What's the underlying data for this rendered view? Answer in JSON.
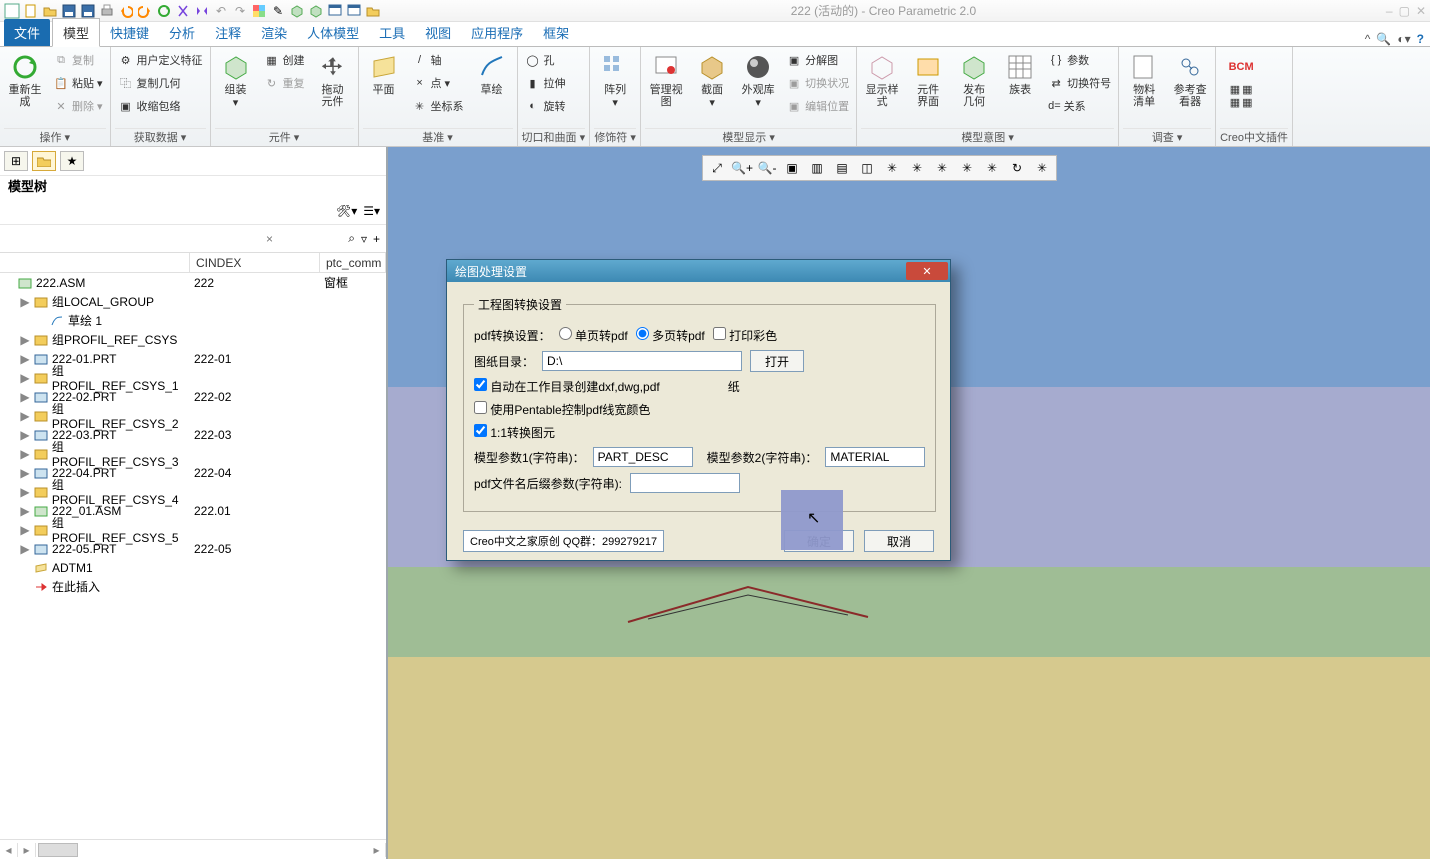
{
  "title": "222 (活动的) - Creo Parametric 2.0",
  "tabs": {
    "file": "文件",
    "list": [
      "模型",
      "快捷键",
      "分析",
      "注释",
      "渲染",
      "人体模型",
      "工具",
      "视图",
      "应用程序",
      "框架"
    ],
    "active": 0
  },
  "ribbon": {
    "g0": {
      "title": "操作",
      "regen": "重新生成",
      "copy": "复制",
      "paste": "粘贴",
      "del": "删除"
    },
    "g1": {
      "title": "获取数据",
      "udf": "用户定义特征",
      "copygeom": "复制几何",
      "shrink": "收缩包络"
    },
    "g2": {
      "title": "元件",
      "asm": "组装",
      "create": "创建",
      "repeat": "重复",
      "drag": "拖动\n元件"
    },
    "g3": {
      "title": "基准",
      "plane": "平面",
      "axis": "轴",
      "point": "点",
      "csys": "坐标系",
      "sketch": "草绘"
    },
    "g4": {
      "title": "切口和曲面",
      "hole": "孔",
      "ext": "拉伸",
      "rev": "旋转"
    },
    "g5": {
      "title": "修饰符",
      "pattern": "阵列"
    },
    "g6": {
      "title": "模型显示",
      "mgrview": "管理视图",
      "sect": "截面",
      "appear": "外观库",
      "explode": "分解图",
      "switch": "切换状况",
      "editpos": "编辑位置"
    },
    "g7": {
      "title": "模型意图",
      "dispstyle": "显示样\n式",
      "compif": "元件\n界面",
      "pubgeom": "发布\n几何",
      "family": "族表",
      "param": "参数",
      "switchsym": "切换符号",
      "rel": "关系"
    },
    "g8": {
      "title": "调查",
      "bom": "物料\n清单",
      "refview": "参考查\n看器"
    },
    "g9": {
      "title": "Creo中文插件",
      "bcm": "BCM"
    }
  },
  "treepanel": {
    "title": "模型树",
    "col1": "CINDEX",
    "col2": "ptc_comm"
  },
  "tree": [
    {
      "ind": 0,
      "ico": "asm",
      "name": "222.ASM",
      "c": "222",
      "p": "窗框",
      "tog": ""
    },
    {
      "ind": 1,
      "ico": "grp",
      "name": "组LOCAL_GROUP",
      "tog": "▶"
    },
    {
      "ind": 2,
      "ico": "sk",
      "name": "草绘 1"
    },
    {
      "ind": 1,
      "ico": "grp",
      "name": "组PROFIL_REF_CSYS",
      "tog": "▶"
    },
    {
      "ind": 1,
      "ico": "prt",
      "name": "222-01.PRT",
      "c": "222-01",
      "tog": "▶"
    },
    {
      "ind": 1,
      "ico": "grp",
      "name": "组PROFIL_REF_CSYS_1",
      "tog": "▶"
    },
    {
      "ind": 1,
      "ico": "prt",
      "name": "222-02.PRT",
      "c": "222-02",
      "tog": "▶"
    },
    {
      "ind": 1,
      "ico": "grp",
      "name": "组PROFIL_REF_CSYS_2",
      "tog": "▶"
    },
    {
      "ind": 1,
      "ico": "prt",
      "name": "222-03.PRT",
      "c": "222-03",
      "tog": "▶"
    },
    {
      "ind": 1,
      "ico": "grp",
      "name": "组PROFIL_REF_CSYS_3",
      "tog": "▶"
    },
    {
      "ind": 1,
      "ico": "prt",
      "name": "222-04.PRT",
      "c": "222-04",
      "tog": "▶"
    },
    {
      "ind": 1,
      "ico": "grp",
      "name": "组PROFIL_REF_CSYS_4",
      "tog": "▶"
    },
    {
      "ind": 1,
      "ico": "asm",
      "name": "222_01.ASM",
      "c": "222.01",
      "tog": "▶"
    },
    {
      "ind": 1,
      "ico": "grp",
      "name": "组PROFIL_REF_CSYS_5",
      "tog": "▶"
    },
    {
      "ind": 1,
      "ico": "prt",
      "name": "222-05.PRT",
      "c": "222-05",
      "tog": "▶"
    },
    {
      "ind": 1,
      "ico": "dtm",
      "name": "ADTM1"
    },
    {
      "ind": 1,
      "ico": "ins",
      "name": "在此插入"
    }
  ],
  "dialog": {
    "title": "绘图处理设置",
    "legend": "工程图转换设置",
    "pdfrow": {
      "label": "pdf转换设置：",
      "opt1": "单页转pdf",
      "opt2": "多页转pdf",
      "opt3": "打印彩色"
    },
    "dirrow": {
      "label": "图纸目录：",
      "value": "D:\\",
      "open": "打开"
    },
    "chk1": "自动在工作目录创建dxf,dwg,pdf",
    "chk1_suffix": "纸",
    "chk2": "使用Pentable控制pdf线宽颜色",
    "chk3": "1:1转换图元",
    "p1": {
      "label": "模型参数1(字符串)：",
      "value": "PART_DESC"
    },
    "p2": {
      "label": "模型参数2(字符串)：",
      "value": "MATERIAL"
    },
    "p3": {
      "label": "pdf文件名后缀参数(字符串):",
      "value": ""
    },
    "credit": "Creo中文之家原创     QQ群：299279217",
    "ok": "确定",
    "cancel": "取消"
  }
}
